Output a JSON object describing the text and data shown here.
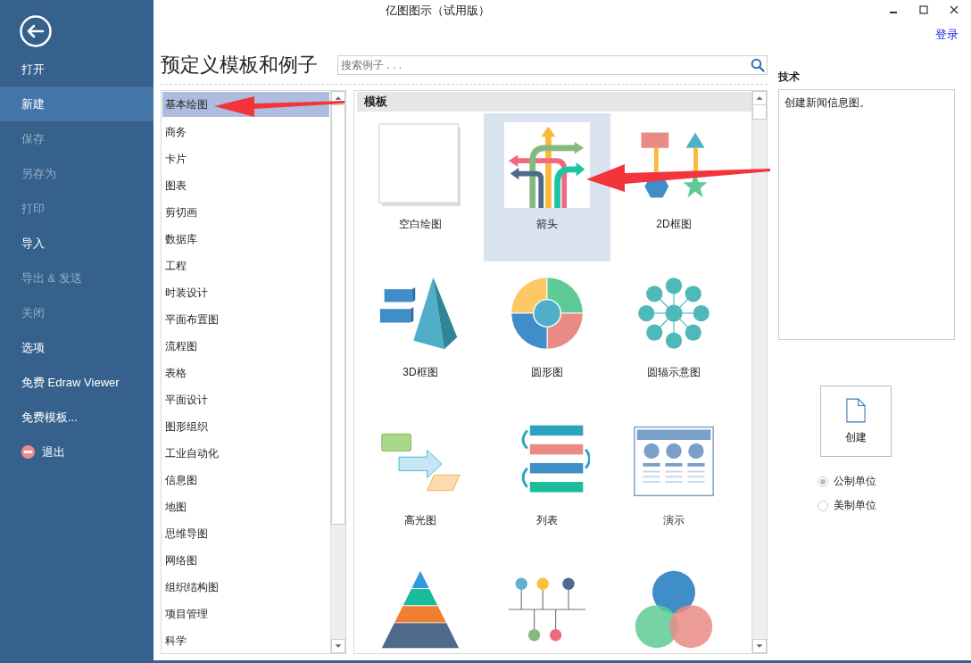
{
  "window": {
    "title": "亿图图示（试用版）"
  },
  "account": {
    "login": "登录"
  },
  "sidebar": {
    "items": [
      {
        "label": "打开",
        "kind": "item",
        "selected": false,
        "disabled": false
      },
      {
        "label": "新建",
        "kind": "item",
        "selected": true,
        "disabled": false
      },
      {
        "label": "保存",
        "kind": "item",
        "selected": false,
        "disabled": true
      },
      {
        "label": "另存为",
        "kind": "item",
        "selected": false,
        "disabled": true
      },
      {
        "label": "打印",
        "kind": "item",
        "selected": false,
        "disabled": true
      },
      {
        "label": "导入",
        "kind": "item",
        "selected": false,
        "disabled": false
      },
      {
        "label": "导出 & 发送",
        "kind": "item",
        "selected": false,
        "disabled": true
      },
      {
        "label": "关闭",
        "kind": "item",
        "selected": false,
        "disabled": true
      },
      {
        "label": "选项",
        "kind": "item",
        "selected": false,
        "disabled": false
      },
      {
        "label": "免费 Edraw Viewer",
        "kind": "item",
        "selected": false,
        "disabled": false
      },
      {
        "label": "免费模板...",
        "kind": "item",
        "selected": false,
        "disabled": false
      },
      {
        "label": "退出",
        "kind": "exit",
        "selected": false,
        "disabled": false
      }
    ]
  },
  "heading": "预定义模板和例子",
  "search": {
    "placeholder": "搜索例子 . . ."
  },
  "categories": [
    {
      "label": "基本绘图",
      "selected": true
    },
    {
      "label": "商务",
      "selected": false
    },
    {
      "label": "卡片",
      "selected": false
    },
    {
      "label": "图表",
      "selected": false
    },
    {
      "label": "剪切画",
      "selected": false
    },
    {
      "label": "数据库",
      "selected": false
    },
    {
      "label": "工程",
      "selected": false
    },
    {
      "label": "时装设计",
      "selected": false
    },
    {
      "label": "平面布置图",
      "selected": false
    },
    {
      "label": "流程图",
      "selected": false
    },
    {
      "label": "表格",
      "selected": false
    },
    {
      "label": "平面设计",
      "selected": false
    },
    {
      "label": "图形组织",
      "selected": false
    },
    {
      "label": "工业自动化",
      "selected": false
    },
    {
      "label": "信息图",
      "selected": false
    },
    {
      "label": "地图",
      "selected": false
    },
    {
      "label": "思维导图",
      "selected": false
    },
    {
      "label": "网络图",
      "selected": false
    },
    {
      "label": "组织结构图",
      "selected": false
    },
    {
      "label": "项目管理",
      "selected": false
    },
    {
      "label": "科学",
      "selected": false
    }
  ],
  "gallery": {
    "section": "模板",
    "templates": [
      {
        "kind": "blank",
        "label": "空白绘图",
        "selected": false
      },
      {
        "kind": "arrows",
        "label": "箭头",
        "selected": true
      },
      {
        "kind": "shapes2d",
        "label": "2D框图",
        "selected": false
      },
      {
        "kind": "shapes3d",
        "label": "3D框图",
        "selected": false
      },
      {
        "kind": "ring",
        "label": "圆形图",
        "selected": false
      },
      {
        "kind": "radial",
        "label": "圆辐示意图",
        "selected": false
      },
      {
        "kind": "highlight",
        "label": "高光图",
        "selected": false
      },
      {
        "kind": "list",
        "label": "列表",
        "selected": false
      },
      {
        "kind": "presentation",
        "label": "演示",
        "selected": false
      },
      {
        "kind": "pyramid",
        "selected": false
      },
      {
        "kind": "timeline",
        "selected": false
      },
      {
        "kind": "venn",
        "selected": false
      }
    ]
  },
  "details": {
    "heading": "技术",
    "description": "创建新闻信息图。",
    "create_button": "创建",
    "units": [
      {
        "label": "公制单位",
        "selected": true
      },
      {
        "label": "美制单位",
        "selected": false
      }
    ]
  }
}
